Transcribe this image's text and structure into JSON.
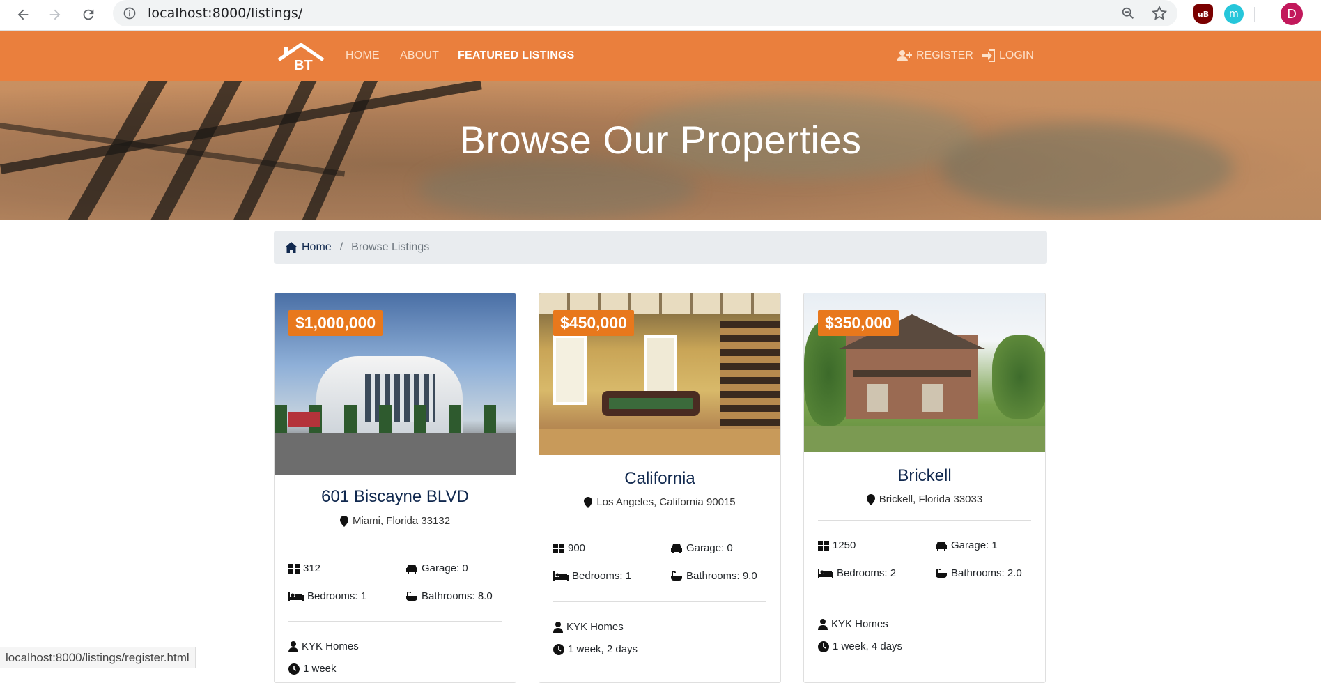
{
  "browser": {
    "url": "localhost:8000/listings/",
    "profile_initial": "D",
    "ext1": "uB",
    "ext2": "m",
    "status_url": "localhost:8000/listings/register.html"
  },
  "nav": {
    "logo_text": "BT",
    "links": [
      "HOME",
      "ABOUT",
      "FEATURED LISTINGS"
    ],
    "register": "REGISTER",
    "login": "LOGIN"
  },
  "showcase": {
    "title": "Browse Our Properties"
  },
  "breadcrumb": {
    "home": "Home",
    "separator": "/",
    "current": "Browse Listings"
  },
  "listings": [
    {
      "price": "$1,000,000",
      "title": "601 Biscayne BLVD",
      "address": "Miami, Florida 33132",
      "sqft": "312",
      "garage": "Garage: 0",
      "bedrooms": "Bedrooms: 1",
      "bathrooms": "Bathrooms: 8.0",
      "realtor": "KYK Homes",
      "listed": "1 week"
    },
    {
      "price": "$450,000",
      "title": "California",
      "address": "Los Angeles, California 90015",
      "sqft": "900",
      "garage": "Garage: 0",
      "bedrooms": "Bedrooms: 1",
      "bathrooms": "Bathrooms: 9.0",
      "realtor": "KYK Homes",
      "listed": "1 week, 2 days"
    },
    {
      "price": "$350,000",
      "title": "Brickell",
      "address": "Brickell, Florida 33033",
      "sqft": "1250",
      "garage": "Garage: 1",
      "bedrooms": "Bedrooms: 2",
      "bathrooms": "Bathrooms: 2.0",
      "realtor": "KYK Homes",
      "listed": "1 week, 4 days"
    }
  ],
  "colors": {
    "nav": "#ea7f3d",
    "price_badge": "#e8781c",
    "heading": "#10284e"
  }
}
